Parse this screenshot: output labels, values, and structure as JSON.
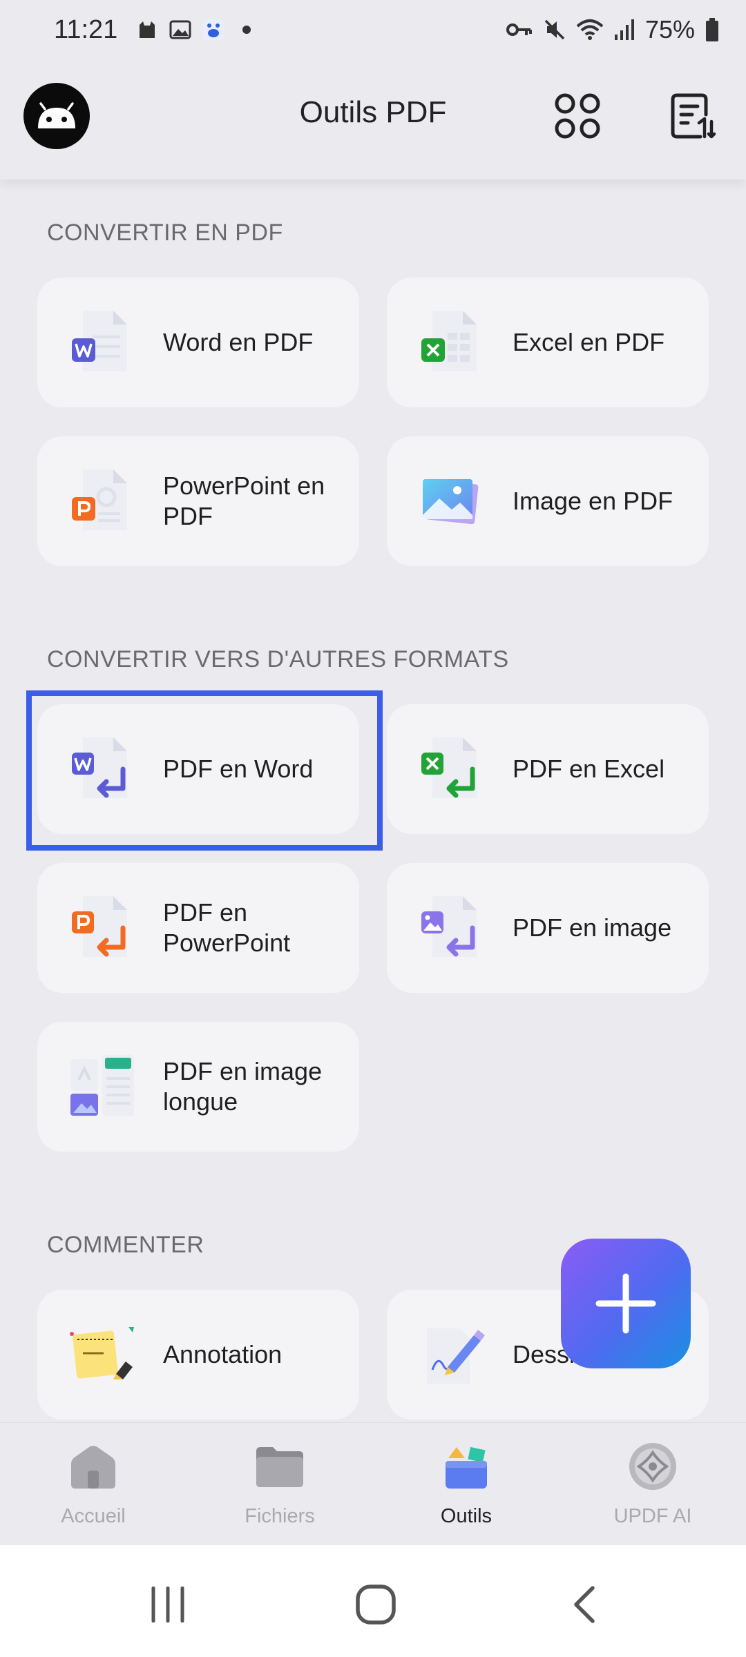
{
  "status_bar": {
    "time": "11:21",
    "battery": "75%"
  },
  "app_bar": {
    "title": "Outils PDF"
  },
  "sections": {
    "convert_to_pdf": {
      "title": "CONVERTIR EN PDF",
      "items": [
        "Word en PDF",
        "Excel en PDF",
        "PowerPoint en PDF",
        "Image en PDF"
      ]
    },
    "convert_other": {
      "title": "CONVERTIR VERS D'AUTRES FORMATS",
      "items": [
        "PDF en Word",
        "PDF en Excel",
        "PDF en PowerPoint",
        "PDF en image",
        "PDF en image longue"
      ]
    },
    "comment": {
      "title": "COMMENTER",
      "items": [
        "Annotation",
        "Dessin"
      ]
    }
  },
  "bottom_nav": {
    "items": [
      {
        "label": "Accueil",
        "icon": "home-icon"
      },
      {
        "label": "Fichiers",
        "icon": "folder-icon"
      },
      {
        "label": "Outils",
        "icon": "tools-icon",
        "active": true
      },
      {
        "label": "UPDF AI",
        "icon": "ai-icon"
      }
    ]
  },
  "colors": {
    "accent": "#3b5de7",
    "word": "#5b5bd6",
    "excel": "#21a336",
    "powerpoint": "#f26b21",
    "image": "#8b74e8"
  }
}
